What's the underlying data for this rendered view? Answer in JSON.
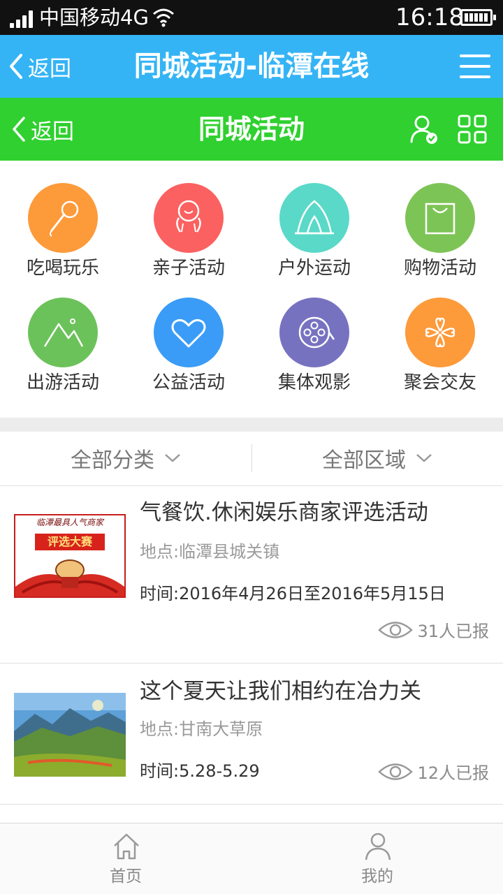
{
  "status_bar": {
    "carrier": "中国移动4G",
    "time": "16:18"
  },
  "top_nav": {
    "back_label": "返回",
    "title": "同城活动-临潭在线",
    "icon": "menu-icon"
  },
  "page_nav": {
    "back_label": "返回",
    "title": "同城活动",
    "icons": [
      "user-verified-icon",
      "grid-icon"
    ],
    "accent": "#2fd02f"
  },
  "categories": [
    {
      "label": "吃喝玩乐",
      "icon": "microphone-icon",
      "color": "#fd9a3a"
    },
    {
      "label": "亲子活动",
      "icon": "hug-icon",
      "color": "#fb6160"
    },
    {
      "label": "户外运动",
      "icon": "tent-icon",
      "color": "#5ad9c8"
    },
    {
      "label": "购物活动",
      "icon": "shopping-bag-icon",
      "color": "#7dc456"
    },
    {
      "label": "出游活动",
      "icon": "mountain-icon",
      "color": "#6cc25a"
    },
    {
      "label": "公益活动",
      "icon": "heart-icon",
      "color": "#3a9cf6"
    },
    {
      "label": "集体观影",
      "icon": "film-reel-icon",
      "color": "#7772c0"
    },
    {
      "label": "聚会交友",
      "icon": "clover-icon",
      "color": "#fd9a3a"
    }
  ],
  "filters": {
    "category": "全部分类",
    "area": "全部区域"
  },
  "events": [
    {
      "title": "气餐饮.休闲娱乐商家评选活动",
      "location": "地点:临潭县城关镇",
      "time": "时间:2016年4月26日至2016年5月15日",
      "views": "31人已报",
      "thumb_text": {
        "line1": "临潭最具人气商家",
        "line2": "评选大赛"
      }
    },
    {
      "title": "这个夏天让我们相约在冶力关",
      "location": "地点:甘南大草原",
      "time": "时间:5.28-5.29",
      "views": "12人已报"
    }
  ],
  "tabs": [
    {
      "label": "首页",
      "icon": "home-icon"
    },
    {
      "label": "我的",
      "icon": "profile-icon"
    }
  ]
}
